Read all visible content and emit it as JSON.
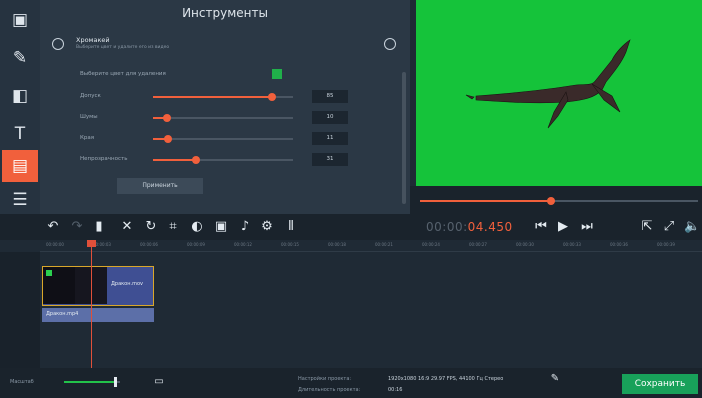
{
  "tools_panel": {
    "title": "Инструменты",
    "effect": {
      "name": "Хромакей",
      "description": "Выберите цвет и удалите его из видео"
    },
    "pick_color_label": "Выберите цвет для удаления",
    "pick_color_swatch": "#20b04a",
    "params": [
      {
        "label": "Допуск",
        "value": "85",
        "fraction": 0.85
      },
      {
        "label": "Шумы",
        "value": "10",
        "fraction": 0.1
      },
      {
        "label": "Края",
        "value": "11",
        "fraction": 0.11
      },
      {
        "label": "Непрозрачность",
        "value": "31",
        "fraction": 0.31
      }
    ],
    "apply_label": "Применить"
  },
  "preview": {
    "background_color": "#15c33a",
    "seek_fraction": 0.47
  },
  "rail": {
    "icons": [
      "video-import-icon",
      "magic-wand-icon",
      "transitions-icon",
      "titles-icon",
      "sticker-icon",
      "menu-icon"
    ]
  },
  "toolbar": {
    "timecode_prefix": "00:00:",
    "timecode_current": "04.450"
  },
  "ruler": {
    "ticks": [
      "00:00:00",
      "00:00:03",
      "00:00:06",
      "00:00:09",
      "00:00:12",
      "00:00:15",
      "00:00:18",
      "00:00:21",
      "00:00:24",
      "00:00:27",
      "00:00:30",
      "00:00:33",
      "00:00:36",
      "00:00:39"
    ]
  },
  "timeline": {
    "clip_name": "Дракон.mov",
    "audio_name": "Дракон.mp4"
  },
  "bottom": {
    "scale_label": "Масштаб",
    "scale_fraction": 0.9,
    "settings_label": "Настройки проекта:",
    "settings_value": "1920x1080 16:9 29.97 FPS, 44100 Гц Стерео",
    "duration_label": "Длительность проекта:",
    "duration_value": "00:16",
    "save_label": "Сохранить"
  }
}
